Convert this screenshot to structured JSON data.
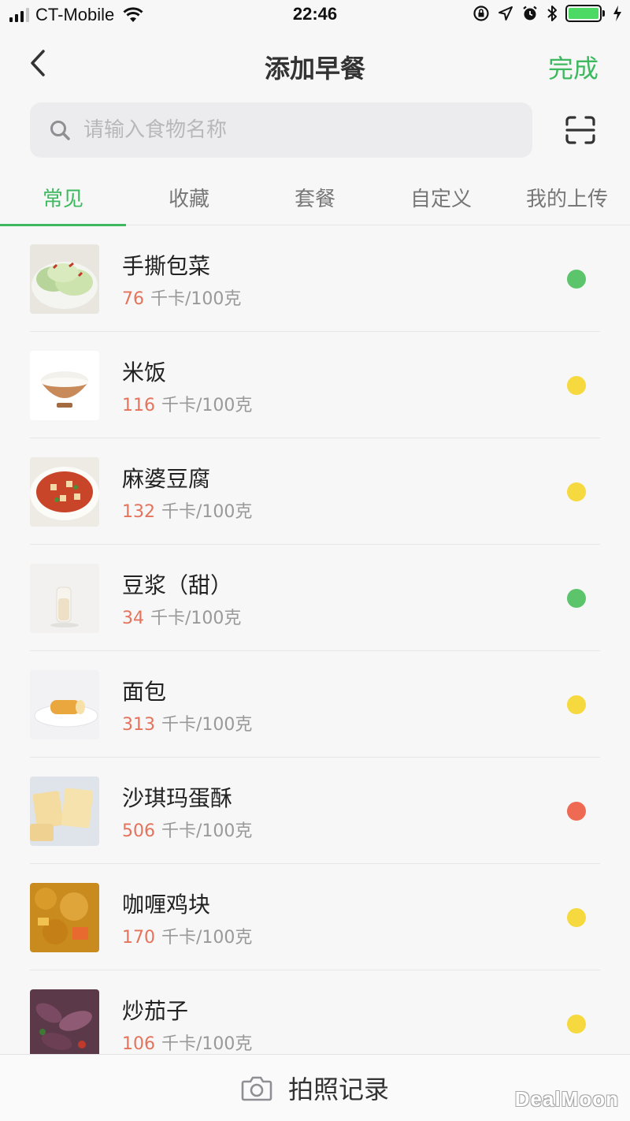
{
  "status_bar": {
    "carrier": "CT-Mobile",
    "time": "22:46",
    "battery_color": "#4cd964"
  },
  "nav": {
    "title": "添加早餐",
    "done_label": "完成",
    "back_icon": "chevron-left-icon"
  },
  "search": {
    "placeholder": "请输入食物名称",
    "value": "",
    "scan_icon": "scan-icon"
  },
  "tabs": [
    {
      "label": "常见",
      "active": true
    },
    {
      "label": "收藏",
      "active": false
    },
    {
      "label": "套餐",
      "active": false
    },
    {
      "label": "自定义",
      "active": false
    },
    {
      "label": "我的上传",
      "active": false
    }
  ],
  "foods": [
    {
      "name": "手撕包菜",
      "calories": "76",
      "unit": "千卡/100克",
      "level": "green"
    },
    {
      "name": "米饭",
      "calories": "116",
      "unit": "千卡/100克",
      "level": "yellow"
    },
    {
      "name": "麻婆豆腐",
      "calories": "132",
      "unit": "千卡/100克",
      "level": "yellow"
    },
    {
      "name": "豆浆（甜）",
      "calories": "34",
      "unit": "千卡/100克",
      "level": "green"
    },
    {
      "name": "面包",
      "calories": "313",
      "unit": "千卡/100克",
      "level": "yellow"
    },
    {
      "name": "沙琪玛蛋酥",
      "calories": "506",
      "unit": "千卡/100克",
      "level": "red"
    },
    {
      "name": "咖喱鸡块",
      "calories": "170",
      "unit": "千卡/100克",
      "level": "yellow"
    },
    {
      "name": "炒茄子",
      "calories": "106",
      "unit": "千卡/100克",
      "level": "yellow"
    }
  ],
  "level_colors": {
    "green": "#5cc46a",
    "yellow": "#f6d93e",
    "red": "#ef6a52"
  },
  "accent_color": "#3fb960",
  "bottom_bar": {
    "label": "拍照记录",
    "icon": "camera-icon"
  },
  "watermark": "DealMoon"
}
